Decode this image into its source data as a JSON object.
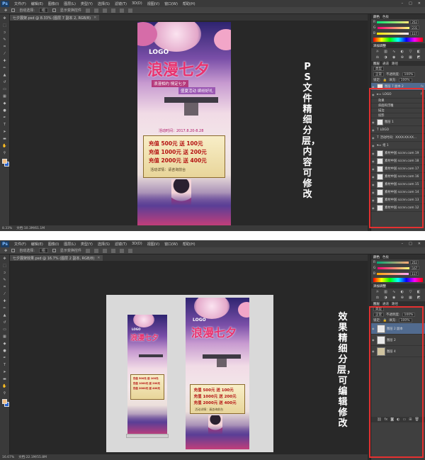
{
  "app": {
    "logo": "Ps"
  },
  "menu": [
    "文件(F)",
    "编辑(E)",
    "图像(I)",
    "图层(L)",
    "类型(Y)",
    "选择(S)",
    "滤镜(T)",
    "3D(D)",
    "视图(V)",
    "窗口(W)",
    "帮助(H)"
  ],
  "window_controls": [
    "–",
    "□",
    "✕"
  ],
  "options": {
    "auto_select": "自动选择:",
    "group": "组",
    "transform": "显示变换控件"
  },
  "window1": {
    "tab": "七夕展架.psd @ 8.33% (图层 7 副本 2, RGB/8)",
    "status": [
      "8.33%",
      "文档:10.3M/61.1M"
    ],
    "caption": "PS文件精细分层，内容可修改",
    "color": {
      "r": "252",
      "g": "231",
      "b": "117"
    },
    "panel_tabs": [
      "颜色",
      "色板"
    ],
    "adjust_title": "添加调整",
    "layers_tabs": [
      "图层",
      "通道",
      "路径"
    ],
    "kind": "类型",
    "blend": "正常",
    "opacity_label": "不透明度:",
    "opacity": "100%",
    "lock_label": "锁定:",
    "fill_label": "填充:",
    "fill": "100%",
    "layers": [
      {
        "name": "图层 7 副本 2",
        "selected": true,
        "fx": "fx"
      },
      {
        "name": "LOGO",
        "group": true,
        "fx": "fx"
      },
      {
        "name": "效果",
        "sub": true
      },
      {
        "name": "斜面和浮雕",
        "sub": true
      },
      {
        "name": "描边",
        "sub": true
      },
      {
        "name": "投影",
        "sub": true
      },
      {
        "name": "图层 1"
      },
      {
        "name": "LOGO"
      },
      {
        "name": "活动时间：XXXX-XX-XX..."
      },
      {
        "name": "组 1",
        "group": true
      },
      {
        "name": "素材中国 sccnn.com 19"
      },
      {
        "name": "素材中国 sccnn.com 18"
      },
      {
        "name": "素材中国 sccnn.com 17"
      },
      {
        "name": "素材中国 sccnn.com 16"
      },
      {
        "name": "素材中国 sccnn.com 15"
      },
      {
        "name": "素材中国 sccnn.com 14"
      },
      {
        "name": "素材中国 sccnn.com 13"
      },
      {
        "name": "素材中国 sccnn.com 12"
      }
    ]
  },
  "window2": {
    "tab": "七夕展架效果.psd @ 16.7% (图层 2 副本, RGB/8)",
    "status": [
      "16.67%",
      "文档:22.1M/55.8M"
    ],
    "caption": "效果精细分层，可编辑修改",
    "color": {
      "r": "252",
      "g": "167",
      "b": "117"
    },
    "panel_tabs": [
      "颜色",
      "色板"
    ],
    "adjust_title": "添加调整",
    "layers_tabs": [
      "图层",
      "通道",
      "路径"
    ],
    "kind": "类型",
    "blend": "正常",
    "opacity_label": "不透明度:",
    "opacity": "100%",
    "lock_label": "锁定:",
    "fill_label": "填充:",
    "fill": "100%",
    "layers": [
      {
        "name": "图层 2 副本",
        "selected": true
      },
      {
        "name": "图层 2"
      },
      {
        "name": "图层 4"
      }
    ]
  },
  "poster": {
    "logo": "LOGO",
    "title": "浪漫七夕",
    "subtitle": "浪漫相约 情定七夕",
    "tagline": "盛夏活动 缤纷好礼",
    "date": "活动时间：2017.8.20-8.28",
    "offers": [
      "充值 500元 送 100元",
      "充值 1000元 送 200元",
      "充值 2000元 送 400元"
    ],
    "note": "活动详情：请咨询前台"
  },
  "colors": {
    "accent_red": "#e53131",
    "panel": "#3f3f3f",
    "canvas": "#282828",
    "selected_layer": "#516b8f"
  }
}
